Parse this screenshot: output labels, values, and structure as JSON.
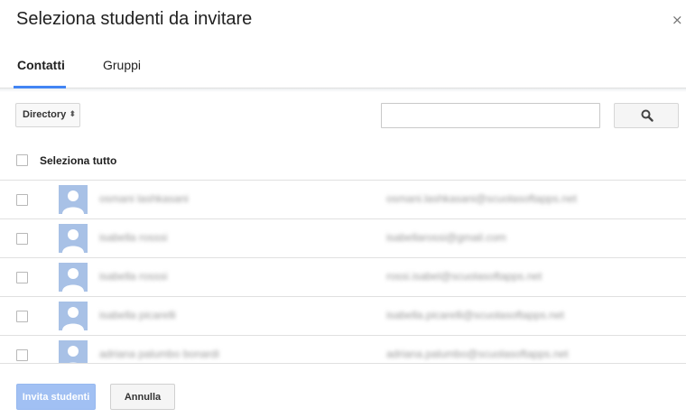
{
  "dialog": {
    "title": "Seleziona studenti da invitare",
    "close_glyph": "×"
  },
  "tabs": [
    {
      "label": "Contatti",
      "active": true
    },
    {
      "label": "Gruppi",
      "active": false
    }
  ],
  "toolbar": {
    "directory_label": "Directory",
    "search_placeholder": "",
    "search_value": ""
  },
  "select_all": {
    "label": "Seleziona tutto",
    "checked": false
  },
  "contacts": [
    {
      "name": "osmani lashkasani",
      "email": "osmani.lashkasani@scuolasoftapps.net"
    },
    {
      "name": "isabella rosssi",
      "email": "isabellarossi@gmail.com"
    },
    {
      "name": "isabella rosssi",
      "email": "rossi.isabel@scuolasoftapps.net"
    },
    {
      "name": "isabella picarelli",
      "email": "isabella.picarelli@scuolasoftapps.net"
    },
    {
      "name": "adriana palumbo bonardi",
      "email": "adriana.palumbo@scuolasoftapps.net"
    }
  ],
  "footer": {
    "invite_label": "Invita studenti",
    "cancel_label": "Annulla"
  },
  "colors": {
    "accent": "#4285f4",
    "invite_disabled": "#a1c0f3",
    "avatar_bg": "#a8c1e6"
  }
}
